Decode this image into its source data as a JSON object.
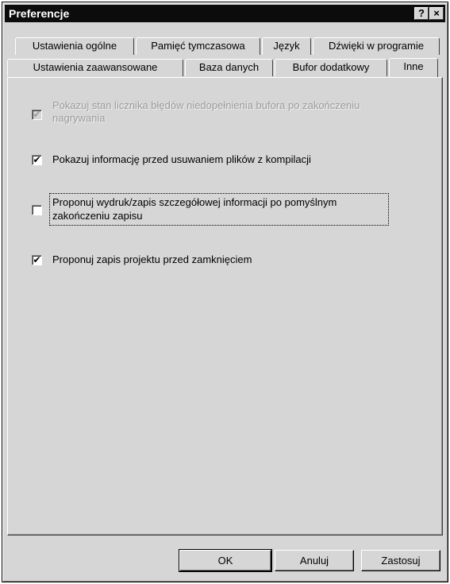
{
  "window": {
    "title": "Preferencje",
    "help_glyph": "?",
    "close_glyph": "×"
  },
  "tabs": {
    "row1": [
      "Ustawienia ogólne",
      "Pamięć tymczasowa",
      "Język",
      "Dźwięki w programie"
    ],
    "row2": [
      "Ustawienia zaawansowane",
      "Baza danych",
      "Bufor dodatkowy",
      "Inne"
    ],
    "active": "Inne"
  },
  "options": [
    {
      "line1": "Pokazuj stan licznika błędów niedopełnienia bufora po zakończeniu",
      "line2": "nagrywania",
      "checked": true,
      "enabled": false
    },
    {
      "line1": "Pokazuj informację przed usuwaniem plików z kompilacji",
      "line2": "",
      "checked": true,
      "enabled": true
    },
    {
      "line1": "Proponuj wydruk/zapis szczegółowej informacji po pomyślnym",
      "line2": "zakończeniu zapisu",
      "checked": false,
      "enabled": true
    },
    {
      "line1": "Proponuj zapis projektu przed zamknięciem",
      "line2": "",
      "checked": true,
      "enabled": true
    }
  ],
  "check_glyph": "✔",
  "buttons": {
    "ok": "OK",
    "cancel": "Anuluj",
    "apply": "Zastosuj"
  }
}
